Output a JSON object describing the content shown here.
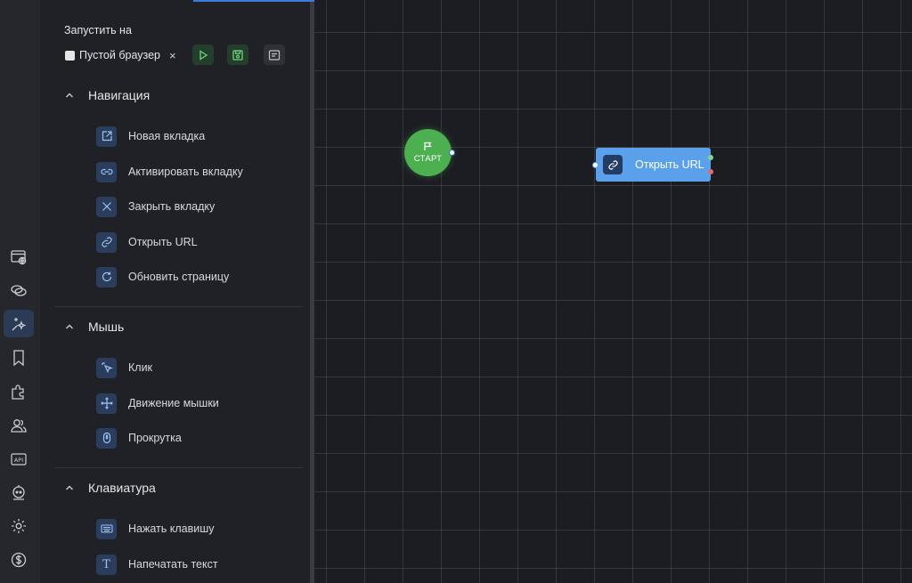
{
  "panel": {
    "run_on_label": "Запустить на",
    "browser_label": "Пустой браузер",
    "close_symbol": "×"
  },
  "sections": [
    {
      "title": "Навигация",
      "items": [
        {
          "label": "Новая вкладка",
          "icon": "new-tab-icon"
        },
        {
          "label": "Активировать вкладку",
          "icon": "link-tab-icon"
        },
        {
          "label": "Закрыть вкладку",
          "icon": "close-tab-icon"
        },
        {
          "label": "Открыть URL",
          "icon": "link-icon"
        },
        {
          "label": "Обновить страницу",
          "icon": "refresh-icon"
        }
      ]
    },
    {
      "title": "Мышь",
      "items": [
        {
          "label": "Клик",
          "icon": "cursor-click-icon"
        },
        {
          "label": "Движение мышки",
          "icon": "move-arrows-icon"
        },
        {
          "label": "Прокрутка",
          "icon": "mouse-scroll-icon"
        }
      ]
    },
    {
      "title": "Клавиатура",
      "items": [
        {
          "label": "Нажать клавишу",
          "icon": "keyboard-icon"
        },
        {
          "label": "Напечатать текст",
          "icon": "text-icon",
          "glyph": "T"
        }
      ]
    }
  ],
  "canvas": {
    "start_node_label": "СТАРТ",
    "url_node_label": "Открыть URL"
  },
  "rail": {
    "items": [
      "browser-globe-icon",
      "links-icon",
      "magic-icon",
      "bookmark-icon",
      "puzzle-icon",
      "users-icon",
      "api-icon",
      "robot-icon",
      "settings-gear-icon",
      "dollar-icon"
    ],
    "api_text": "API",
    "active": "magic-icon"
  },
  "colors": {
    "accent": "#3f7bd8",
    "start_green": "#4caf50",
    "node_blue": "#5aa0ea"
  }
}
